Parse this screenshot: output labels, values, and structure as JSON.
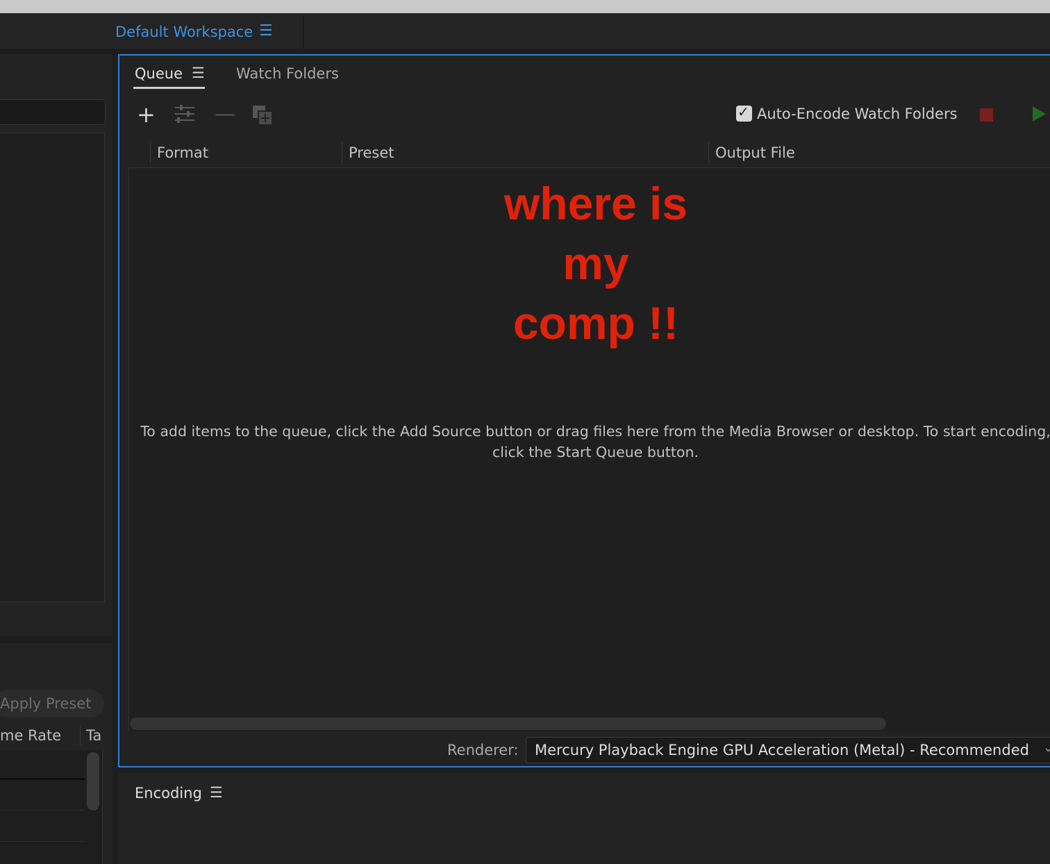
{
  "header": {
    "workspace_label": "Default Workspace",
    "menu_icon": "☰"
  },
  "left_panel": {
    "apply_preset_label": "Apply Preset",
    "columns": [
      "me Rate",
      "Ta"
    ]
  },
  "queue_panel": {
    "tabs": [
      {
        "label": "Queue",
        "active": true,
        "menu_icon": "☰"
      },
      {
        "label": "Watch Folders",
        "active": false
      }
    ],
    "toolbar": {
      "add_icon": "+",
      "remove_icon": "—"
    },
    "auto_encode": {
      "label": "Auto-Encode Watch Folders",
      "checked": true,
      "check_glyph": "✓"
    },
    "columns": [
      "Format",
      "Preset",
      "Output File"
    ],
    "annotation": [
      "where is",
      "my",
      "comp !!"
    ],
    "instructions": "To add items to the queue, click the Add Source button or drag files here from the Media Browser or desktop.  To start encoding, click the Start Queue button.",
    "renderer": {
      "label": "Renderer:",
      "value": "Mercury Playback Engine GPU Acceleration (Metal) - Recommended",
      "chevron": "⌄"
    }
  },
  "encoding_panel": {
    "title": "Encoding",
    "menu_icon": "☰"
  },
  "colors": {
    "accent_blue": "#3d93e0",
    "panel_border": "#2f7fd2",
    "annotation_red": "#e0220a",
    "stop_red": "#7a1f1f",
    "play_green": "#236b23"
  }
}
